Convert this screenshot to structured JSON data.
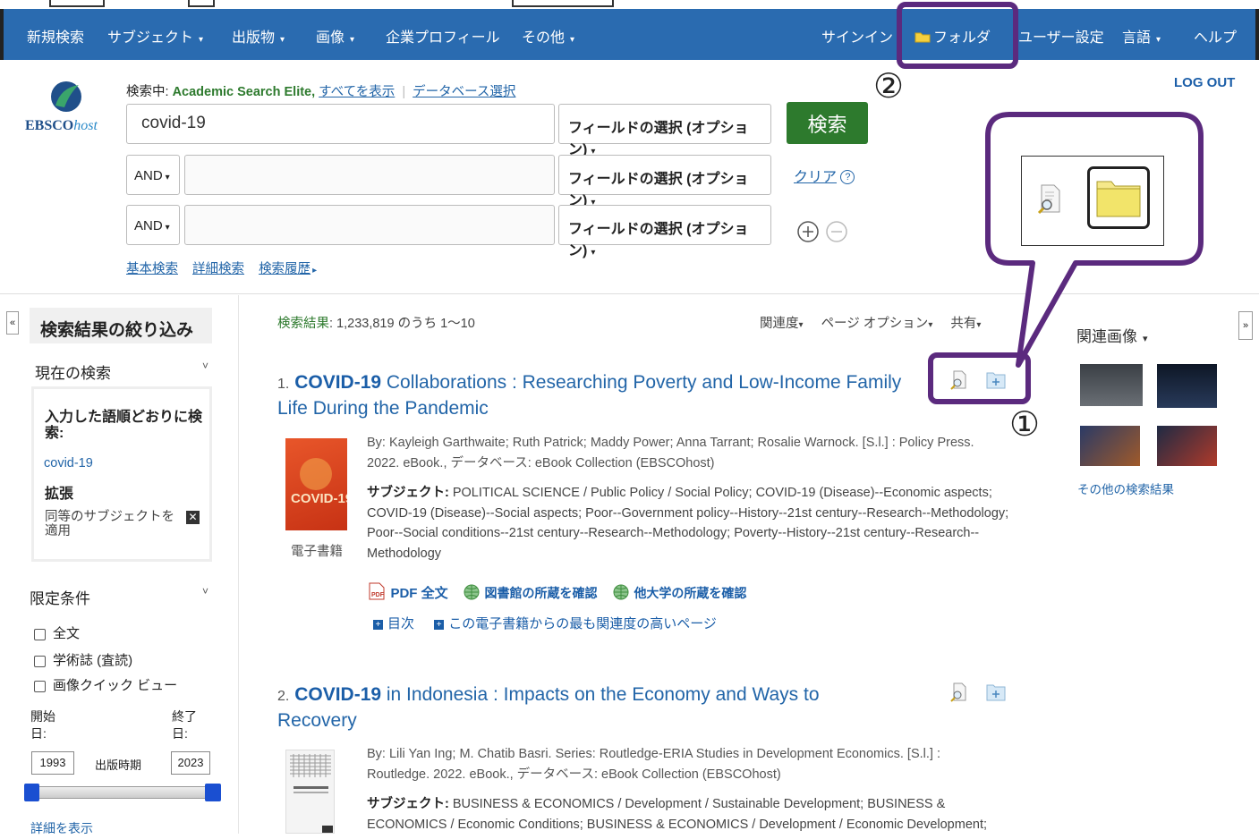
{
  "nav": {
    "new_search": "新規検索",
    "subjects": "サブジェクト",
    "publications": "出版物",
    "images": "画像",
    "company_profiles": "企業プロフィール",
    "more": "その他",
    "sign_in": "サインイン",
    "folder": "フォルダ",
    "preferences": "ユーザー設定",
    "languages": "言語",
    "help": "ヘルプ"
  },
  "logout": "LOG OUT",
  "logo": {
    "brand": "EBSCO",
    "suffix": "host"
  },
  "search": {
    "searching_prefix": "検索中:",
    "database": "Academic Search Elite,",
    "show_all": "すべてを表示",
    "choose_db": "データベース選択",
    "row1_value": "covid-19",
    "field_select_label": "フィールドの選択 (オプション)",
    "bool_label": "AND",
    "search_button": "検索",
    "clear": "クリア",
    "basic": "基本検索",
    "advanced": "詳細検索",
    "history": "検索履歴"
  },
  "callouts": {
    "one": "①",
    "two": "②"
  },
  "refine": {
    "title": "検索結果の絞り込み",
    "current_search": "現在の検索",
    "boolean_phrase": "入力した語順どおりに検索:",
    "term": "covid-19",
    "expanders": "拡張",
    "apply_equiv": "同等のサブジェクトを適用",
    "limit_to": "限定条件",
    "full_text": "全文",
    "scholarly": "学術誌 (査読)",
    "image_quick_view": "画像クイック ビュー",
    "start_label": "開始日:",
    "end_label": "終了日:",
    "start_year": "1993",
    "end_year": "2023",
    "pub_date": "出版時期",
    "show_more": "詳細を表示"
  },
  "results": {
    "count_label": "検索結果",
    "count_text": ": 1,233,819 のうち 1～10",
    "relevance": "関連度",
    "page_options": "ページ オプション",
    "share": "共有",
    "items": [
      {
        "num": "1.",
        "title_bold": "COVID-19",
        "title_rest": " Collaborations : Researching Poverty and Low-Income Family Life During the Pandemic",
        "meta1": "By: Kayleigh Garthwaite; Ruth Patrick; Maddy Power; Anna Tarrant; Rosalie Warnock. [S.l.] : Policy Press.",
        "meta2": "2022. eBook., データベース: eBook Collection (EBSCOhost)",
        "subject_label": "サブジェクト:",
        "subjects": " POLITICAL SCIENCE / Public Policy / Social Policy; COVID-19 (Disease)--Economic aspects; COVID-19 (Disease)--Social aspects; Poor--Government policy--History--21st century--Research--Methodology; Poor--Social conditions--21st century--Research--Methodology; Poverty--History--21st century--Research--Methodology",
        "type": "電子書籍",
        "pdf": "PDF 全文",
        "lib1": "図書館の所蔵を確認",
        "lib2": "他大学の所蔵を確認",
        "toc": "目次",
        "relevant_pages": "この電子書籍からの最も関連度の高いページ"
      },
      {
        "num": "2.",
        "title_bold": "COVID-19",
        "title_rest": " in Indonesia : Impacts on the Economy and Ways to Recovery",
        "meta1": "By: Lili Yan Ing; M. Chatib Basri. Series: Routledge-ERIA Studies in Development Economics. [S.l.] :",
        "meta2": "Routledge. 2022. eBook., データベース: eBook Collection (EBSCOhost)",
        "subject_label": "サブジェクト:",
        "subjects": " BUSINESS & ECONOMICS / Development / Sustainable Development; BUSINESS & ECONOMICS / Economic Conditions; BUSINESS & ECONOMICS / Development / Economic Development;"
      }
    ]
  },
  "related_images": {
    "title": "関連画像",
    "more": "その他の検索結果"
  },
  "colors": {
    "nav": "#2a6bb0",
    "highlight": "#5b2a7e",
    "search_btn": "#2d7a2d",
    "link": "#2265a8"
  }
}
